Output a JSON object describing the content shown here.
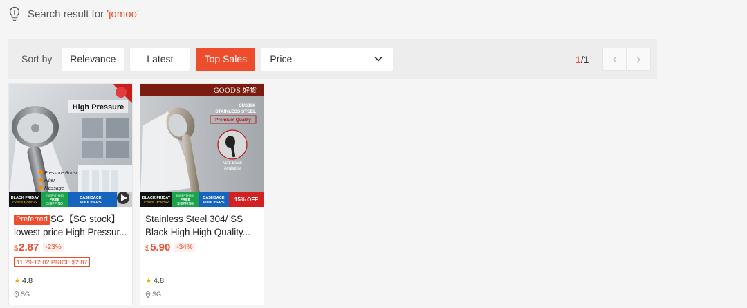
{
  "search": {
    "prefix": "Search result for ",
    "open_quote": "'",
    "keyword": "jomoo",
    "close_quote": "'"
  },
  "sort": {
    "label": "Sort by",
    "options": [
      "Relevance",
      "Latest",
      "Top Sales"
    ],
    "active": "Top Sales",
    "price_select": "Price"
  },
  "pagination": {
    "current": "1",
    "total": "/1",
    "prev_icon": "chevron-left-icon",
    "next_icon": "chevron-right-icon"
  },
  "colors": {
    "accent": "#ee4d2d",
    "background": "#f5f5f5",
    "sortbar": "#ededed",
    "star": "#f6a700"
  },
  "products": [
    {
      "badge": "Preferred",
      "title_line1": "SG【SG stock】",
      "title_line2": "lowest price High Pressur...",
      "currency": "$",
      "price": "2.87",
      "discount": "-23%",
      "promo": "11.29-12.02 PRICE:$2.87",
      "rating": "4.8",
      "location": "SG",
      "image_texts": {
        "headline": "High Pressure",
        "features": [
          "Pressure Boost",
          "Filter",
          "Massage"
        ],
        "banner": [
          "BLACK FRIDAY",
          "CYBER MONDAY",
          "EVERYTHING",
          "FREE",
          "SHIPPING",
          "CASHBACK",
          "VOUCHERS"
        ]
      }
    },
    {
      "badge": "",
      "title_line1": "Stainless Steel 304/ SS",
      "title_line2": "Black High High Quality...",
      "currency": "$",
      "price": "5.90",
      "discount": "-34%",
      "promo": "",
      "rating": "4.8",
      "location": "SG",
      "image_texts": {
        "brand": "GOODS 好货",
        "sus": "SUS304",
        "steel": "STAINLESS STEEL",
        "quality": "Premium Quality",
        "matt1": "Matt Black",
        "matt2": "Available",
        "banner": [
          "BLACK FRIDAY",
          "CYBER MONDAY",
          "EVERYTHING",
          "FREE",
          "SHIPPING",
          "CASHBACK",
          "VOUCHERS",
          "15% OFF"
        ]
      }
    }
  ]
}
